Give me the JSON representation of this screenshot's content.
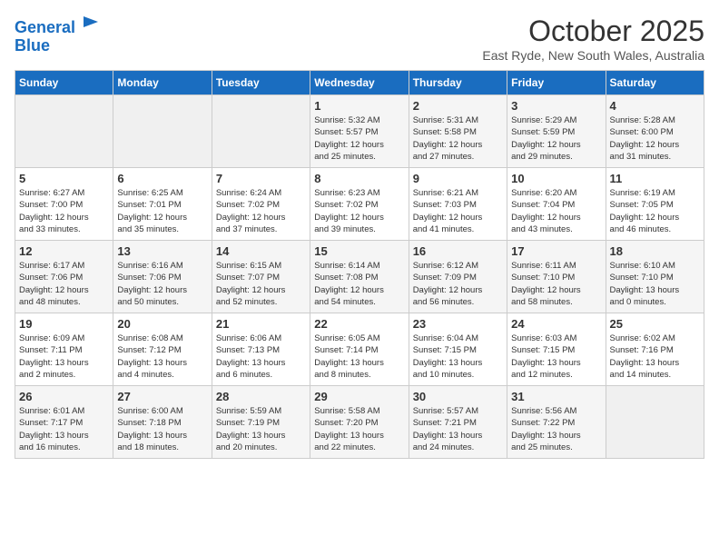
{
  "header": {
    "logo_line1": "General",
    "logo_line2": "Blue",
    "month": "October 2025",
    "location": "East Ryde, New South Wales, Australia"
  },
  "days_of_week": [
    "Sunday",
    "Monday",
    "Tuesday",
    "Wednesday",
    "Thursday",
    "Friday",
    "Saturday"
  ],
  "weeks": [
    [
      {
        "day": "",
        "info": ""
      },
      {
        "day": "",
        "info": ""
      },
      {
        "day": "",
        "info": ""
      },
      {
        "day": "1",
        "info": "Sunrise: 5:32 AM\nSunset: 5:57 PM\nDaylight: 12 hours\nand 25 minutes."
      },
      {
        "day": "2",
        "info": "Sunrise: 5:31 AM\nSunset: 5:58 PM\nDaylight: 12 hours\nand 27 minutes."
      },
      {
        "day": "3",
        "info": "Sunrise: 5:29 AM\nSunset: 5:59 PM\nDaylight: 12 hours\nand 29 minutes."
      },
      {
        "day": "4",
        "info": "Sunrise: 5:28 AM\nSunset: 6:00 PM\nDaylight: 12 hours\nand 31 minutes."
      }
    ],
    [
      {
        "day": "5",
        "info": "Sunrise: 6:27 AM\nSunset: 7:00 PM\nDaylight: 12 hours\nand 33 minutes."
      },
      {
        "day": "6",
        "info": "Sunrise: 6:25 AM\nSunset: 7:01 PM\nDaylight: 12 hours\nand 35 minutes."
      },
      {
        "day": "7",
        "info": "Sunrise: 6:24 AM\nSunset: 7:02 PM\nDaylight: 12 hours\nand 37 minutes."
      },
      {
        "day": "8",
        "info": "Sunrise: 6:23 AM\nSunset: 7:02 PM\nDaylight: 12 hours\nand 39 minutes."
      },
      {
        "day": "9",
        "info": "Sunrise: 6:21 AM\nSunset: 7:03 PM\nDaylight: 12 hours\nand 41 minutes."
      },
      {
        "day": "10",
        "info": "Sunrise: 6:20 AM\nSunset: 7:04 PM\nDaylight: 12 hours\nand 43 minutes."
      },
      {
        "day": "11",
        "info": "Sunrise: 6:19 AM\nSunset: 7:05 PM\nDaylight: 12 hours\nand 46 minutes."
      }
    ],
    [
      {
        "day": "12",
        "info": "Sunrise: 6:17 AM\nSunset: 7:06 PM\nDaylight: 12 hours\nand 48 minutes."
      },
      {
        "day": "13",
        "info": "Sunrise: 6:16 AM\nSunset: 7:06 PM\nDaylight: 12 hours\nand 50 minutes."
      },
      {
        "day": "14",
        "info": "Sunrise: 6:15 AM\nSunset: 7:07 PM\nDaylight: 12 hours\nand 52 minutes."
      },
      {
        "day": "15",
        "info": "Sunrise: 6:14 AM\nSunset: 7:08 PM\nDaylight: 12 hours\nand 54 minutes."
      },
      {
        "day": "16",
        "info": "Sunrise: 6:12 AM\nSunset: 7:09 PM\nDaylight: 12 hours\nand 56 minutes."
      },
      {
        "day": "17",
        "info": "Sunrise: 6:11 AM\nSunset: 7:10 PM\nDaylight: 12 hours\nand 58 minutes."
      },
      {
        "day": "18",
        "info": "Sunrise: 6:10 AM\nSunset: 7:10 PM\nDaylight: 13 hours\nand 0 minutes."
      }
    ],
    [
      {
        "day": "19",
        "info": "Sunrise: 6:09 AM\nSunset: 7:11 PM\nDaylight: 13 hours\nand 2 minutes."
      },
      {
        "day": "20",
        "info": "Sunrise: 6:08 AM\nSunset: 7:12 PM\nDaylight: 13 hours\nand 4 minutes."
      },
      {
        "day": "21",
        "info": "Sunrise: 6:06 AM\nSunset: 7:13 PM\nDaylight: 13 hours\nand 6 minutes."
      },
      {
        "day": "22",
        "info": "Sunrise: 6:05 AM\nSunset: 7:14 PM\nDaylight: 13 hours\nand 8 minutes."
      },
      {
        "day": "23",
        "info": "Sunrise: 6:04 AM\nSunset: 7:15 PM\nDaylight: 13 hours\nand 10 minutes."
      },
      {
        "day": "24",
        "info": "Sunrise: 6:03 AM\nSunset: 7:15 PM\nDaylight: 13 hours\nand 12 minutes."
      },
      {
        "day": "25",
        "info": "Sunrise: 6:02 AM\nSunset: 7:16 PM\nDaylight: 13 hours\nand 14 minutes."
      }
    ],
    [
      {
        "day": "26",
        "info": "Sunrise: 6:01 AM\nSunset: 7:17 PM\nDaylight: 13 hours\nand 16 minutes."
      },
      {
        "day": "27",
        "info": "Sunrise: 6:00 AM\nSunset: 7:18 PM\nDaylight: 13 hours\nand 18 minutes."
      },
      {
        "day": "28",
        "info": "Sunrise: 5:59 AM\nSunset: 7:19 PM\nDaylight: 13 hours\nand 20 minutes."
      },
      {
        "day": "29",
        "info": "Sunrise: 5:58 AM\nSunset: 7:20 PM\nDaylight: 13 hours\nand 22 minutes."
      },
      {
        "day": "30",
        "info": "Sunrise: 5:57 AM\nSunset: 7:21 PM\nDaylight: 13 hours\nand 24 minutes."
      },
      {
        "day": "31",
        "info": "Sunrise: 5:56 AM\nSunset: 7:22 PM\nDaylight: 13 hours\nand 25 minutes."
      },
      {
        "day": "",
        "info": ""
      }
    ]
  ]
}
